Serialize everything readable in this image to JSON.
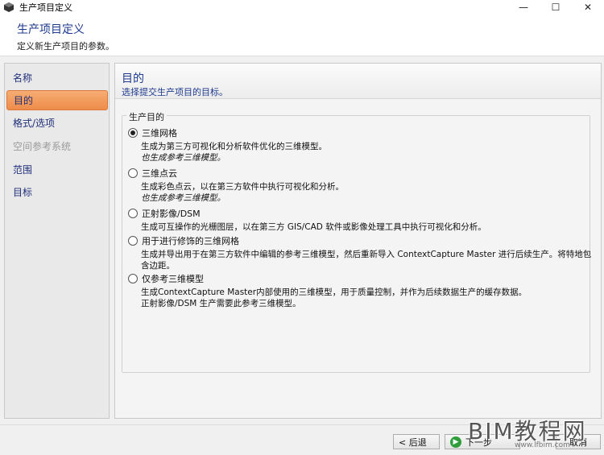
{
  "window": {
    "title": "生产项目定义",
    "minimize": "—",
    "maximize": "☐",
    "close": "✕"
  },
  "header": {
    "title": "生产项目定义",
    "subtitle": "定义新生产项目的参数。"
  },
  "sidebar": {
    "items": [
      {
        "label": "名称",
        "state": "normal"
      },
      {
        "label": "目的",
        "state": "active"
      },
      {
        "label": "格式/选项",
        "state": "normal"
      },
      {
        "label": "空间参考系统",
        "state": "disabled"
      },
      {
        "label": "范围",
        "state": "normal"
      },
      {
        "label": "目标",
        "state": "normal"
      }
    ]
  },
  "content": {
    "title": "目的",
    "subtitle": "选择提交生产项目的目标。",
    "group_label": "生产目的",
    "options": [
      {
        "label": "三维网格",
        "checked": true,
        "desc": "生成为第三方可视化和分析软件优化的三维模型。",
        "note": "也生成参考三维模型。"
      },
      {
        "label": "三维点云",
        "checked": false,
        "desc": "生成彩色点云，以在第三方软件中执行可视化和分析。",
        "note": "也生成参考三维模型。"
      },
      {
        "label": "正射影像/DSM",
        "checked": false,
        "desc": "生成可互操作的光栅图层，以在第三方 GIS/CAD 软件或影像处理工具中执行可视化和分析。"
      },
      {
        "label": "用于进行修饰的三维网格",
        "checked": false,
        "desc": "生成并导出用于在第三方软件中编辑的参考三维模型，然后重新导入 ContextCapture Master 进行后续生产。将特地包含边距。"
      },
      {
        "label": "仅参考三维模型",
        "checked": false,
        "desc": "生成ContextCapture Master内部使用的三维模型，用于质量控制，并作为后续数据生产的缓存数据。",
        "note2": "正射影像/DSM 生产需要此参考三维模型。"
      }
    ]
  },
  "footer": {
    "back": "< 后退",
    "next": "下一步",
    "cancel": "取消"
  },
  "watermark": {
    "text": "BIM教程网",
    "url": "www.lfbim.com"
  },
  "colors": {
    "accent_title": "#1e3a8f",
    "active_nav": "#ee8c4a",
    "next_icon": "#2f9e3a"
  }
}
